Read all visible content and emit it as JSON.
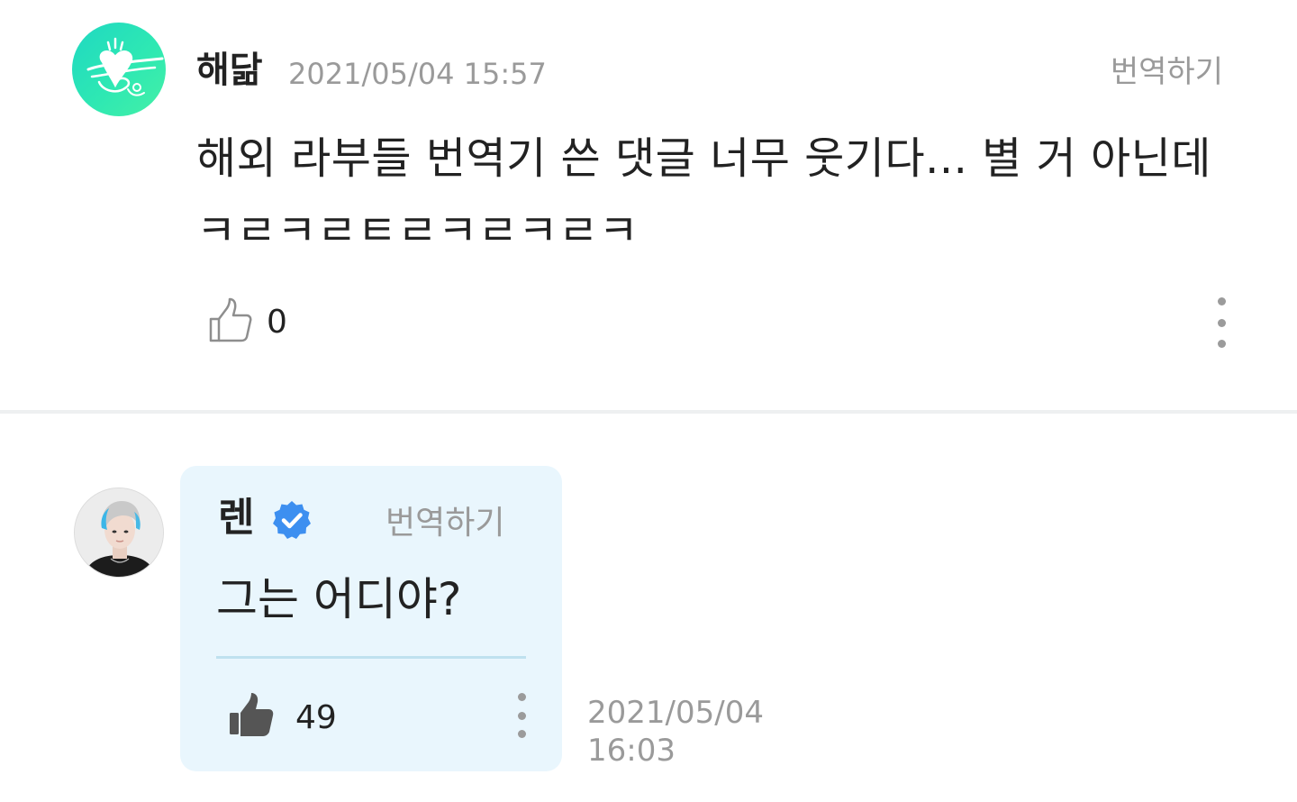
{
  "comment": {
    "author": "해닮",
    "timestamp": "2021/05/04 15:57",
    "translate_label": "번역하기",
    "text": "해외 라부들 번역기 쓴 댓글 너무 웃기다... 별 거 아닌데 ㅋㄹㅋㄹㅌㄹㅋㄹㅋㄹㅋ",
    "like_count": "0",
    "icons": {
      "avatar": "heart-logo-avatar",
      "like": "thumbs-up-outline-icon",
      "more": "more-vertical-icon"
    },
    "colors": {
      "avatar_gradient_start": "#1fd8c2",
      "avatar_gradient_end": "#45f0a6"
    }
  },
  "reply": {
    "author": "렌",
    "translate_label": "번역하기",
    "text": "그는 어디야?",
    "like_count": "49",
    "date": "2021/05/04",
    "time": "16:03",
    "icons": {
      "avatar": "profile-photo-avatar",
      "verified": "verified-badge-icon",
      "like": "thumbs-up-filled-icon",
      "more": "more-vertical-icon"
    },
    "colors": {
      "bubble_background": "#e9f6fd",
      "verified_badge": "#3d8ff0"
    }
  }
}
